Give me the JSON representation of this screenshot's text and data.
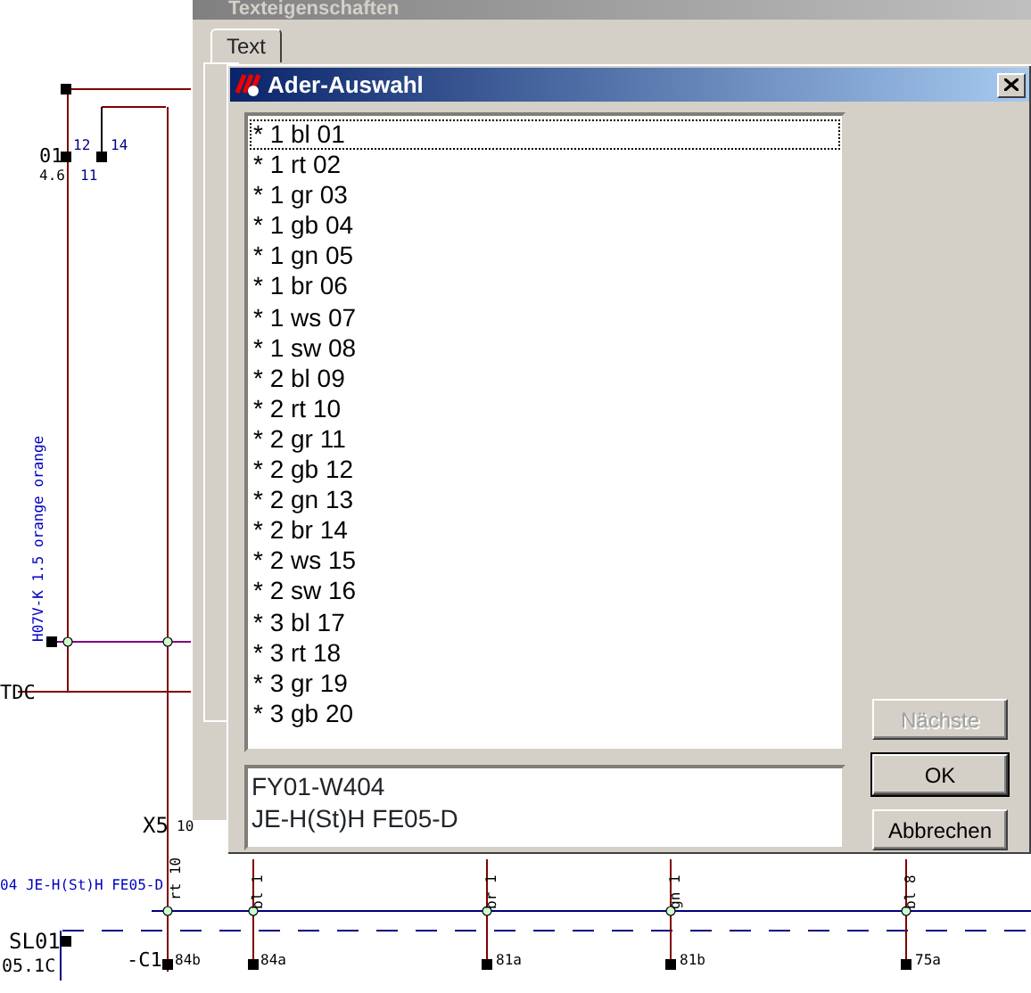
{
  "schematic": {
    "labels": [
      {
        "text": "01",
        "kind": "device"
      },
      {
        "text": "4.6",
        "kind": "device"
      },
      {
        "text": "12",
        "kind": "pin"
      },
      {
        "text": "14",
        "kind": "pin"
      },
      {
        "text": "11",
        "kind": "pin"
      },
      {
        "text": "H07V-K 1.5 orange orange",
        "kind": "wire"
      },
      {
        "text": "TDC",
        "kind": "device"
      },
      {
        "text": "X5",
        "kind": "device"
      },
      {
        "text": "10",
        "kind": "device"
      },
      {
        "text": "rt 10",
        "kind": "device"
      },
      {
        "text": "04 JE-H(St)H FE05-D",
        "kind": "wire"
      },
      {
        "text": "SL01",
        "kind": "device"
      },
      {
        "text": "05.1C",
        "kind": "device"
      },
      {
        "text": "-C1",
        "kind": "device"
      },
      {
        "text": "84b",
        "kind": "device"
      },
      {
        "text": "bl 1",
        "kind": "device"
      },
      {
        "text": "84a",
        "kind": "device"
      },
      {
        "text": "br 1",
        "kind": "device"
      },
      {
        "text": "81a",
        "kind": "device"
      },
      {
        "text": "gn 1",
        "kind": "device"
      },
      {
        "text": "81b",
        "kind": "device"
      },
      {
        "text": "bl 8",
        "kind": "device"
      },
      {
        "text": "75a",
        "kind": "device"
      }
    ]
  },
  "background_window": {
    "title": "Texteigenschaften",
    "tabs": [
      {
        "label": "Text",
        "selected": true
      }
    ]
  },
  "dialog": {
    "title": "Ader-Auswahl",
    "list": [
      {
        "label": "* 1 bl 01",
        "selected": true
      },
      {
        "label": "* 1 rt 02",
        "selected": false
      },
      {
        "label": "* 1 gr 03",
        "selected": false
      },
      {
        "label": "* 1 gb 04",
        "selected": false
      },
      {
        "label": "* 1 gn 05",
        "selected": false
      },
      {
        "label": "* 1 br 06",
        "selected": false
      },
      {
        "label": "* 1 ws 07",
        "selected": false
      },
      {
        "label": "* 1 sw 08",
        "selected": false
      },
      {
        "label": "* 2 bl 09",
        "selected": false
      },
      {
        "label": "* 2 rt 10",
        "selected": false
      },
      {
        "label": "* 2 gr 11",
        "selected": false
      },
      {
        "label": "* 2 gb 12",
        "selected": false
      },
      {
        "label": "* 2 gn 13",
        "selected": false
      },
      {
        "label": "* 2 br 14",
        "selected": false
      },
      {
        "label": "* 2 ws 15",
        "selected": false
      },
      {
        "label": "* 2 sw 16",
        "selected": false
      },
      {
        "label": "* 3 bl 17",
        "selected": false
      },
      {
        "label": "* 3 rt 18",
        "selected": false
      },
      {
        "label": "* 3 gr 19",
        "selected": false
      },
      {
        "label": "* 3 gb 20",
        "selected": false
      }
    ],
    "info_lines": [
      "FY01-W404",
      "JE-H(St)H FE05-D"
    ],
    "buttons": [
      {
        "label": "Nächste",
        "disabled": true
      },
      {
        "label": "OK",
        "disabled": false
      },
      {
        "label": "Abbrechen",
        "disabled": false
      }
    ]
  }
}
